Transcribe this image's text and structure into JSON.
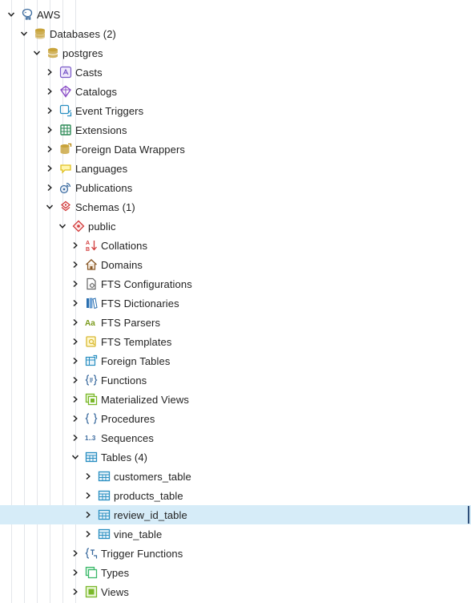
{
  "tree": [
    {
      "id": "aws",
      "label": "AWS",
      "depth": 0,
      "state": "expanded",
      "icon": "elephant-icon",
      "color": "#3a6a9e"
    },
    {
      "id": "databases",
      "label": "Databases (2)",
      "depth": 1,
      "state": "expanded",
      "icon": "database-stack-icon",
      "color": "#c8a33a"
    },
    {
      "id": "postgres",
      "label": "postgres",
      "depth": 2,
      "state": "expanded",
      "icon": "database-icon",
      "color": "#c8a33a"
    },
    {
      "id": "casts",
      "label": "Casts",
      "depth": 3,
      "state": "collapsed",
      "icon": "casts-icon",
      "color": "#7a5ac8"
    },
    {
      "id": "catalogs",
      "label": "Catalogs",
      "depth": 3,
      "state": "collapsed",
      "icon": "catalog-icon",
      "color": "#8b4fc7"
    },
    {
      "id": "event-triggers",
      "label": "Event Triggers",
      "depth": 3,
      "state": "collapsed",
      "icon": "event-trigger-icon",
      "color": "#2a8fc1"
    },
    {
      "id": "extensions",
      "label": "Extensions",
      "depth": 3,
      "state": "collapsed",
      "icon": "extension-icon",
      "color": "#2e8b57"
    },
    {
      "id": "fdw",
      "label": "Foreign Data Wrappers",
      "depth": 3,
      "state": "collapsed",
      "icon": "foreign-data-wrapper-icon",
      "color": "#c8a33a"
    },
    {
      "id": "languages",
      "label": "Languages",
      "depth": 3,
      "state": "collapsed",
      "icon": "language-icon",
      "color": "#e0c020"
    },
    {
      "id": "publications",
      "label": "Publications",
      "depth": 3,
      "state": "collapsed",
      "icon": "publication-icon",
      "color": "#3a6a9e"
    },
    {
      "id": "schemas",
      "label": "Schemas (1)",
      "depth": 3,
      "state": "expanded",
      "icon": "schemas-icon",
      "color": "#d23c3c"
    },
    {
      "id": "public",
      "label": "public",
      "depth": 4,
      "state": "expanded",
      "icon": "schema-icon",
      "color": "#d23c3c"
    },
    {
      "id": "collations",
      "label": "Collations",
      "depth": 5,
      "state": "collapsed",
      "icon": "collation-icon",
      "color": "#d23c3c"
    },
    {
      "id": "domains",
      "label": "Domains",
      "depth": 5,
      "state": "collapsed",
      "icon": "domain-icon",
      "color": "#8a5a2a"
    },
    {
      "id": "fts-configurations",
      "label": "FTS Configurations",
      "depth": 5,
      "state": "collapsed",
      "icon": "fts-configuration-icon",
      "color": "#666666"
    },
    {
      "id": "fts-dictionaries",
      "label": "FTS Dictionaries",
      "depth": 5,
      "state": "collapsed",
      "icon": "fts-dictionary-icon",
      "color": "#2a6fb0"
    },
    {
      "id": "fts-parsers",
      "label": "FTS Parsers",
      "depth": 5,
      "state": "collapsed",
      "icon": "fts-parser-icon",
      "color": "#7a9a1a"
    },
    {
      "id": "fts-templates",
      "label": "FTS Templates",
      "depth": 5,
      "state": "collapsed",
      "icon": "fts-template-icon",
      "color": "#d8b830"
    },
    {
      "id": "foreign-tables",
      "label": "Foreign Tables",
      "depth": 5,
      "state": "collapsed",
      "icon": "foreign-table-icon",
      "color": "#2a8fc1"
    },
    {
      "id": "functions",
      "label": "Functions",
      "depth": 5,
      "state": "collapsed",
      "icon": "function-icon",
      "color": "#3a6a9e"
    },
    {
      "id": "materialized-views",
      "label": "Materialized Views",
      "depth": 5,
      "state": "collapsed",
      "icon": "materialized-view-icon",
      "color": "#7ab82a"
    },
    {
      "id": "procedures",
      "label": "Procedures",
      "depth": 5,
      "state": "collapsed",
      "icon": "procedure-icon",
      "color": "#3a6a9e"
    },
    {
      "id": "sequences",
      "label": "Sequences",
      "depth": 5,
      "state": "collapsed",
      "icon": "sequence-icon",
      "color": "#3a6a9e",
      "icon_text": "1..3"
    },
    {
      "id": "tables",
      "label": "Tables (4)",
      "depth": 5,
      "state": "expanded",
      "icon": "tables-icon",
      "color": "#2a8fc1"
    },
    {
      "id": "customers-table",
      "label": "customers_table",
      "depth": 6,
      "state": "collapsed",
      "icon": "table-icon",
      "color": "#2a8fc1"
    },
    {
      "id": "products-table",
      "label": "products_table",
      "depth": 6,
      "state": "collapsed",
      "icon": "table-icon",
      "color": "#2a8fc1"
    },
    {
      "id": "review-id-table",
      "label": "review_id_table",
      "depth": 6,
      "state": "collapsed",
      "icon": "table-icon",
      "color": "#2a8fc1",
      "selected": true
    },
    {
      "id": "vine-table",
      "label": "vine_table",
      "depth": 6,
      "state": "collapsed",
      "icon": "table-icon",
      "color": "#2a8fc1"
    },
    {
      "id": "trigger-functions",
      "label": "Trigger Functions",
      "depth": 5,
      "state": "collapsed",
      "icon": "trigger-function-icon",
      "color": "#3a6a9e"
    },
    {
      "id": "types",
      "label": "Types",
      "depth": 5,
      "state": "collapsed",
      "icon": "type-icon",
      "color": "#3ab86a"
    },
    {
      "id": "views",
      "label": "Views",
      "depth": 5,
      "state": "collapsed",
      "icon": "view-icon",
      "color": "#7ab82a"
    }
  ]
}
